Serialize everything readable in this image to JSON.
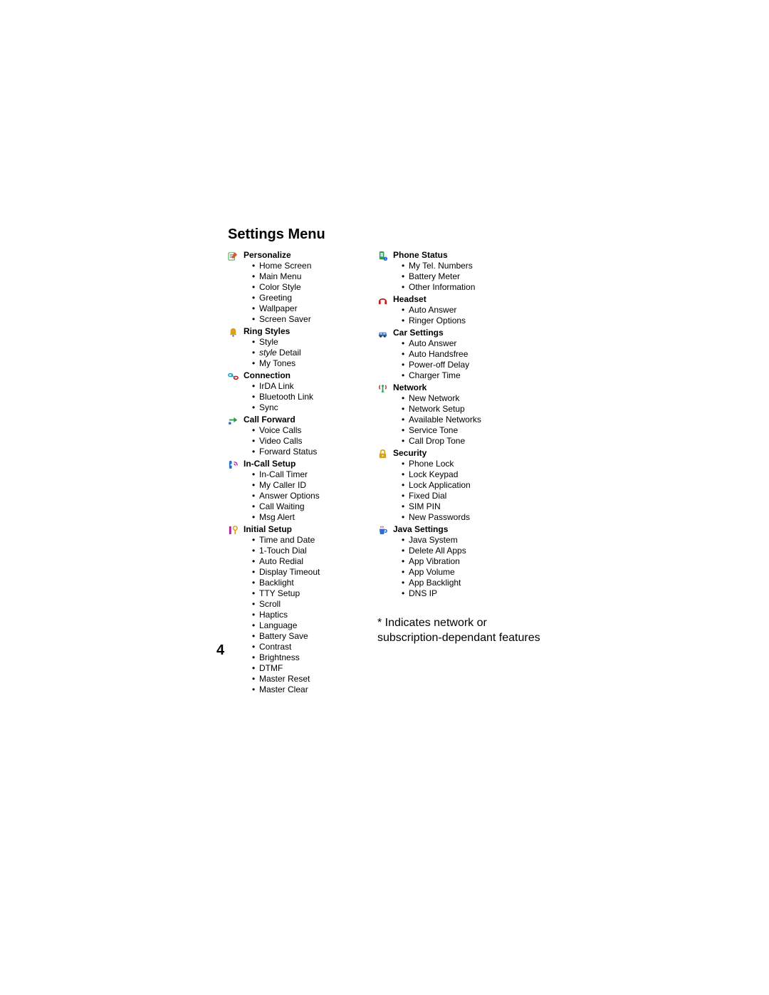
{
  "title": "Settings Menu",
  "page_number": "4",
  "footnote": "* Indicates network or subscription-dependant features",
  "columns": [
    [
      {
        "icon": "personalize-icon",
        "heading": "Personalize",
        "items": [
          {
            "text": "Home Screen"
          },
          {
            "text": "Main Menu"
          },
          {
            "text": "Color Style"
          },
          {
            "text": "Greeting"
          },
          {
            "text": "Wallpaper"
          },
          {
            "text": "Screen Saver"
          }
        ]
      },
      {
        "icon": "ring-styles-icon",
        "heading": "Ring Styles",
        "items": [
          {
            "text": "Style"
          },
          {
            "text_italic_prefix": "style",
            "text_rest": " Detail"
          },
          {
            "text": "My Tones"
          }
        ]
      },
      {
        "icon": "connection-icon",
        "heading": "Connection",
        "items": [
          {
            "text": "IrDA Link"
          },
          {
            "text": "Bluetooth Link"
          },
          {
            "text": "Sync"
          }
        ]
      },
      {
        "icon": "call-forward-icon",
        "heading": "Call Forward",
        "items": [
          {
            "text": "Voice Calls"
          },
          {
            "text": "Video Calls"
          },
          {
            "text": "Forward Status"
          }
        ]
      },
      {
        "icon": "in-call-setup-icon",
        "heading": "In-Call Setup",
        "items": [
          {
            "text": "In-Call Timer"
          },
          {
            "text": "My Caller ID"
          },
          {
            "text": "Answer Options"
          },
          {
            "text": "Call Waiting"
          },
          {
            "text": "Msg Alert"
          }
        ]
      },
      {
        "icon": "initial-setup-icon",
        "heading": "Initial Setup",
        "items": [
          {
            "text": "Time and Date"
          },
          {
            "text": "1-Touch Dial"
          },
          {
            "text": "Auto Redial"
          },
          {
            "text": "Display Timeout"
          },
          {
            "text": "Backlight"
          },
          {
            "text": "TTY Setup"
          },
          {
            "text": "Scroll"
          },
          {
            "text": "Haptics"
          },
          {
            "text": "Language"
          },
          {
            "text": "Battery Save"
          },
          {
            "text": "Contrast"
          },
          {
            "text": "Brightness"
          },
          {
            "text": "DTMF"
          },
          {
            "text": "Master Reset"
          },
          {
            "text": "Master Clear"
          }
        ]
      }
    ],
    [
      {
        "icon": "phone-status-icon",
        "heading": "Phone Status",
        "items": [
          {
            "text": "My Tel. Numbers"
          },
          {
            "text": "Battery Meter"
          },
          {
            "text": "Other Information"
          }
        ]
      },
      {
        "icon": "headset-icon",
        "heading": "Headset",
        "items": [
          {
            "text": "Auto Answer"
          },
          {
            "text": "Ringer Options"
          }
        ]
      },
      {
        "icon": "car-settings-icon",
        "heading": "Car Settings",
        "items": [
          {
            "text": "Auto Answer"
          },
          {
            "text": "Auto Handsfree"
          },
          {
            "text": "Power-off Delay"
          },
          {
            "text": "Charger Time"
          }
        ]
      },
      {
        "icon": "network-icon",
        "heading": "Network",
        "items": [
          {
            "text": "New Network"
          },
          {
            "text": "Network Setup"
          },
          {
            "text": "Available Networks"
          },
          {
            "text": "Service Tone"
          },
          {
            "text": "Call Drop Tone"
          }
        ]
      },
      {
        "icon": "security-icon",
        "heading": "Security",
        "items": [
          {
            "text": "Phone Lock"
          },
          {
            "text": "Lock Keypad"
          },
          {
            "text": "Lock Application"
          },
          {
            "text": "Fixed Dial"
          },
          {
            "text": "SIM PIN"
          },
          {
            "text": "New Passwords"
          }
        ]
      },
      {
        "icon": "java-settings-icon",
        "heading": "Java Settings",
        "items": [
          {
            "text": "Java System"
          },
          {
            "text": "Delete All Apps"
          },
          {
            "text": "App Vibration"
          },
          {
            "text": "App Volume"
          },
          {
            "text": "App Backlight"
          },
          {
            "text": "DNS IP"
          }
        ]
      }
    ]
  ],
  "icons": {
    "personalize-icon": {
      "primary": "#d85a2a",
      "secondary": "#4aa03c",
      "shape": "note-pencil"
    },
    "ring-styles-icon": {
      "primary": "#d8a21a",
      "secondary": "#2a6cd8",
      "shape": "bell"
    },
    "connection-icon": {
      "primary": "#1aa0c8",
      "secondary": "#c01a1a",
      "shape": "link"
    },
    "call-forward-icon": {
      "primary": "#2a9d4a",
      "secondary": "#2a6cd8",
      "shape": "arrows"
    },
    "in-call-setup-icon": {
      "primary": "#2a6cd8",
      "secondary": "#b01aa0",
      "shape": "phone-side"
    },
    "initial-setup-icon": {
      "primary": "#b01aa0",
      "secondary": "#d8a21a",
      "shape": "tools"
    },
    "phone-status-icon": {
      "primary": "#2a9d4a",
      "secondary": "#2a6cd8",
      "shape": "phone-info"
    },
    "headset-icon": {
      "primary": "#c01a1a",
      "secondary": "#d8a21a",
      "shape": "headphones"
    },
    "car-settings-icon": {
      "primary": "#3a79c8",
      "secondary": "#2a9d4a",
      "shape": "car"
    },
    "network-icon": {
      "primary": "#2a9d4a",
      "secondary": "#c01a1a",
      "shape": "antenna"
    },
    "security-icon": {
      "primary": "#d8a21a",
      "secondary": "#2a9d4a",
      "shape": "lock"
    },
    "java-settings-icon": {
      "primary": "#2a6cd8",
      "secondary": "#c01a1a",
      "shape": "cup"
    }
  }
}
